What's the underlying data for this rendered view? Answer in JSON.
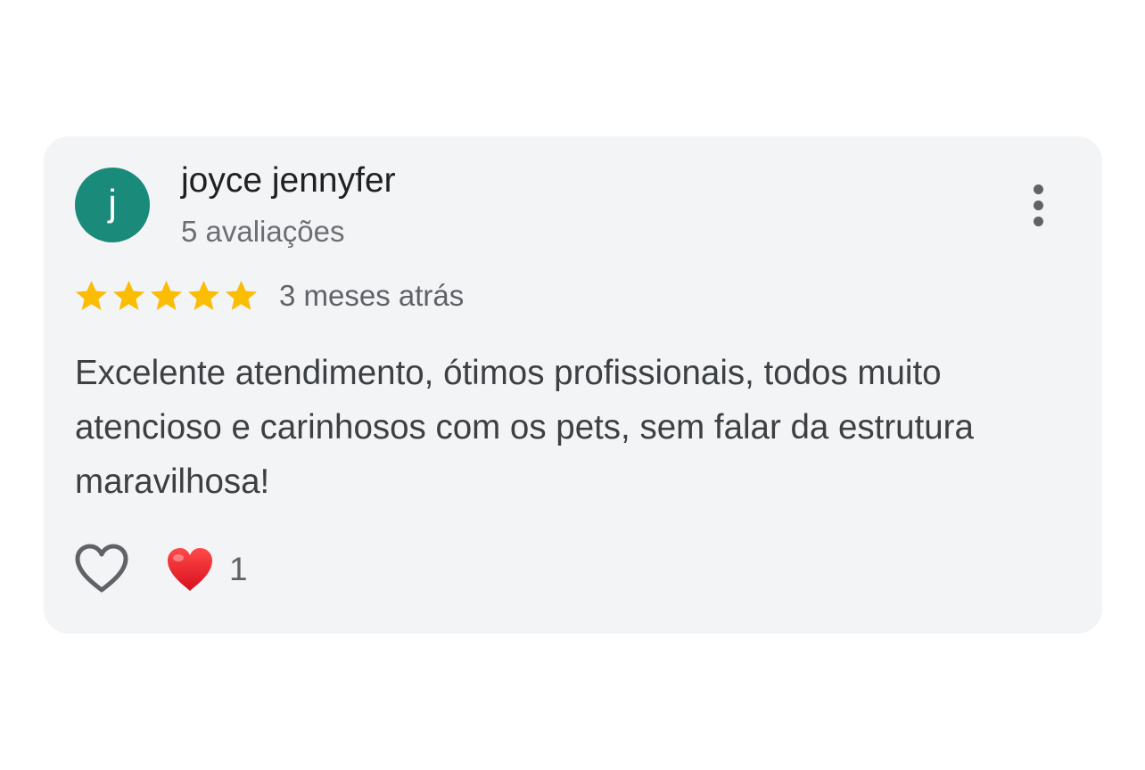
{
  "review": {
    "author": {
      "initial": "j",
      "name": "joyce jennyfer",
      "review_count": "5 avaliações",
      "avatar_color": "#1a8a7a"
    },
    "rating": 5,
    "rating_max": 5,
    "star_color": "#fbbc04",
    "time_ago": "3 meses atrás",
    "text": "Excelente atendimento, ótimos profissionais, todos muito atencioso e carinhosos com os pets, sem falar da estrutura maravilhosa!",
    "menu_icon": "more-vertical-icon",
    "actions": {
      "like_icon": "heart-outline-icon",
      "reaction_icon": "red-heart-icon",
      "reaction_count": "1"
    }
  }
}
